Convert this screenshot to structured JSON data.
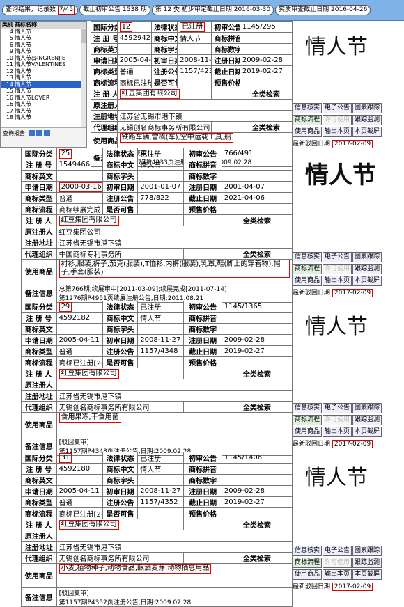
{
  "topbar": {
    "query_label": "查询结果，记录数",
    "query_value": "7/45",
    "issue_label": "截止初审公告",
    "issue_value": "1538",
    "issue_unit": "期",
    "class_label": "第",
    "class_value": "12",
    "class_unit": "类",
    "date_label": "初步审定截止日期",
    "date_value": "2016-03-30",
    "pub_label": "实质审查截止日期",
    "pub_value": "2016-04-26"
  },
  "list": {
    "header": [
      "类别",
      "商标名称"
    ],
    "rows": [
      [
        "4",
        "情人节"
      ],
      [
        "5",
        "情人节"
      ],
      [
        "6",
        "情人节"
      ],
      [
        "9",
        "情人节"
      ],
      [
        "10",
        "情人节@INGRENJIE"
      ],
      [
        "11",
        "情人节VALENTINES"
      ],
      [
        "12",
        "情人节"
      ],
      [
        "13",
        "情人节"
      ],
      [
        "14",
        "情人节"
      ],
      [
        "15",
        "情人节"
      ],
      [
        "16",
        "情人节LOVER"
      ],
      [
        "16",
        "情人节"
      ],
      [
        "17",
        "情人节"
      ],
      [
        "18",
        "情人节"
      ]
    ],
    "footer": "查询报告"
  },
  "labels": {
    "class": "国际分类",
    "status": "法律状态",
    "first_pub": "初审公告",
    "reg_no": "注 册 号",
    "cn_name": "商标中文",
    "pinyin": "商标拼音",
    "en_name": "商标英文",
    "chars": "商标字头",
    "digits": "商标数字",
    "app_date": "申请日期",
    "first_date": "初审日期",
    "reg_date": "注册日期",
    "type": "商标类型",
    "reg_pub": "注册公告",
    "end_date": "截止日期",
    "flow": "商标流程",
    "available": "是否可售",
    "price": "预售价格",
    "registrant": "注 册 人",
    "orig_reg": "原注册人",
    "address": "注册地址",
    "agent": "代理组织",
    "use_goods": "使用商品",
    "remark": "备注信息",
    "full_search": "全类检索",
    "latest": "最新驳回日期"
  },
  "buttons": {
    "verify": "信息核实",
    "gazette": "电子公告",
    "track": "图素跟踪",
    "flow": "商标流程",
    "license": "许可使用",
    "monitor": "跟踪监测",
    "goods": "使用商品",
    "export": "输出本页",
    "shot": "本页截屏"
  },
  "records": [
    {
      "class": "12",
      "status": "已注册",
      "first_pub": "1145/295",
      "reg_no": "4592942",
      "cn_name": "情人节",
      "en_name": "",
      "app_date": "2005-04-11",
      "first_date": "2008-11-27",
      "reg_date": "2009-02-28",
      "type": "普通",
      "reg_pub": "1157/4233",
      "end_date": "2019-02-27",
      "flow": "商标已注册[2(",
      "registrant": "红豆集团有限公司",
      "orig_reg": "",
      "address": "江苏省无锡市港下镇",
      "agent": "无锡创名商标事务所有限公司",
      "use_goods": "铁路车辆,雪橇(车),空中运载工具,船",
      "remark": "[驳回复审]\n第1157期P4233页注册公告,日期:2009.02.28",
      "mark": "情人节",
      "latest_date": "2017-02-09"
    },
    {
      "class": "25",
      "status": "已注册",
      "first_pub": "766/491",
      "reg_no": "1549466",
      "cn_name": "情人节",
      "en_name": "",
      "app_date": "2000-03-16",
      "first_date": "2001-01-07",
      "reg_date": "2001-04-07",
      "type": "普通",
      "reg_pub": "778/822",
      "end_date": "2021-04-06",
      "flow": "商标续展完成",
      "registrant": "红豆集团有限公司",
      "orig_reg": "红豆集团公司",
      "address": "江苏省无锡市港下镇",
      "agent": "中国商标专利事务所",
      "use_goods": "衬衫,服装,裤子,茄克(服装),T恤衫,内裤(服装),乳罩,鞋(脚上的穿着物),帽子,手套(服装)",
      "remark": "总第766期;续展审中[2011-03-09];续展完成[2011-07-14]\n第1276期P4951页续展注册公告,日期:2011.08.21",
      "mark": "情人节",
      "latest_date": "2017-02-09"
    },
    {
      "class": "29",
      "status": "已注册",
      "first_pub": "1145/1365",
      "reg_no": "4592182",
      "cn_name": "情人节",
      "en_name": "",
      "app_date": "2005-04-11",
      "first_date": "2008-11-27",
      "reg_date": "2009-02-28",
      "type": "普通",
      "reg_pub": "1157/4348",
      "end_date": "2019-02-27",
      "flow": "商标已注册[2(",
      "registrant": "红豆集团有限公司",
      "orig_reg": "",
      "address": "江苏省无锡市港下镇",
      "agent": "无锡创名商标事务所有限公司",
      "use_goods": "食用果冻,干食用菌",
      "remark": "[驳回复审]\n第1157期P4348页注册公告,日期:2009.02.28",
      "mark": "情人节",
      "latest_date": "2017-02-09"
    },
    {
      "class": "31",
      "status": "已注册",
      "first_pub": "1145/1406",
      "reg_no": "4592180",
      "cn_name": "情人节",
      "en_name": "",
      "app_date": "2005-04-11",
      "first_date": "2008-11-27",
      "reg_date": "2009-02-28",
      "type": "普通",
      "reg_pub": "1157/4352",
      "end_date": "2019-02-27",
      "flow": "商标已注册[2(",
      "registrant": "红豆集团有限公司",
      "orig_reg": "",
      "address": "江苏省无锡市港下镇",
      "agent": "无锡创名商标事务所有限公司",
      "use_goods": "小麦,植物种子,动物食品,酿酒麦芽,动物栖息用品",
      "remark": "[驳回复审]\n第1157期P4352页注册公告,日期:2009.02.28",
      "mark": "情人节",
      "latest_date": "2017-02-09"
    }
  ]
}
